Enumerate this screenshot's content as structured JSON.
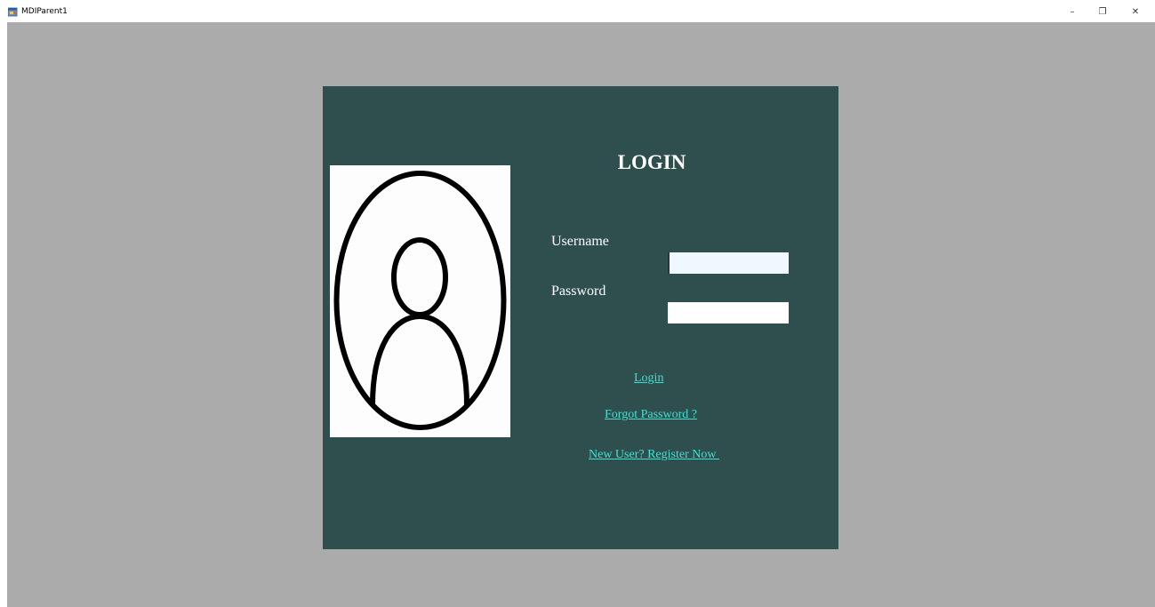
{
  "window": {
    "title": "MDIParent1",
    "minimize_glyph": "–",
    "restore_glyph": "❐",
    "close_glyph": "✕"
  },
  "login": {
    "heading": "LOGIN",
    "username_label": "Username",
    "password_label": "Password",
    "username_value": "",
    "password_value": "",
    "login_link": "Login",
    "forgot_link": "Forgot Password ?",
    "register_link": "New User? Register Now "
  },
  "colors": {
    "mdi_background": "#ababab",
    "form_background": "#2f4f4f",
    "link_color": "#40e0d0"
  },
  "icons": {
    "app_icon": "form-app-icon",
    "avatar": "user-avatar-icon"
  }
}
